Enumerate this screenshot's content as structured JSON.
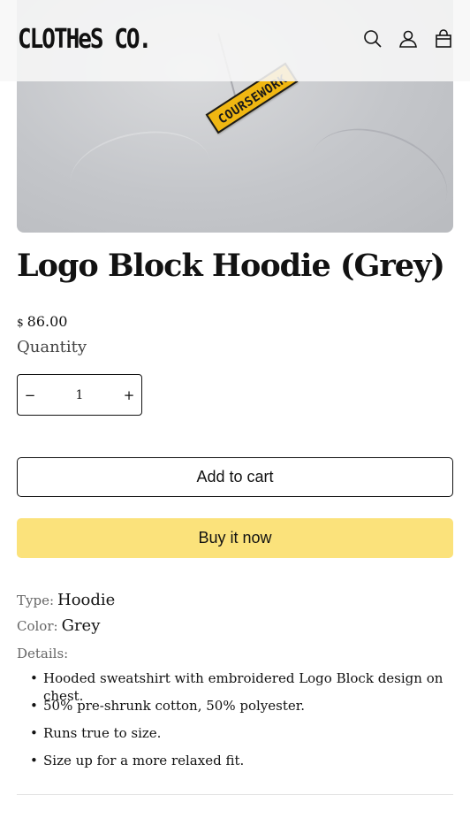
{
  "brand": {
    "logo_text": "CLOTHeS CO."
  },
  "header": {
    "icons": [
      "search-icon",
      "account-icon",
      "cart-icon"
    ]
  },
  "hero": {
    "badge_text": "COURSEWORK"
  },
  "product": {
    "title": "Logo Block Hoodie (Grey)",
    "currency_symbol": "$",
    "price": "86.00",
    "quantity_label": "Quantity",
    "quantity_value": "1",
    "decrease_symbol": "−",
    "increase_symbol": "+",
    "add_to_cart_label": "Add to cart",
    "buy_now_label": "Buy it now",
    "type_label": "Type:",
    "type_value": "Hoodie",
    "color_label": "Color:",
    "color_value": "Grey",
    "details_label": "Details:",
    "details": [
      "Hooded sweatshirt with embroidered Logo Block design on chest.",
      "50% pre-shrunk cotton, 50% polyester.",
      "Runs true to size.",
      "Size up for a more relaxed fit."
    ]
  },
  "colors": {
    "buy_button": "#fbe27b",
    "text": "#121212",
    "badge": "#f0b712"
  }
}
